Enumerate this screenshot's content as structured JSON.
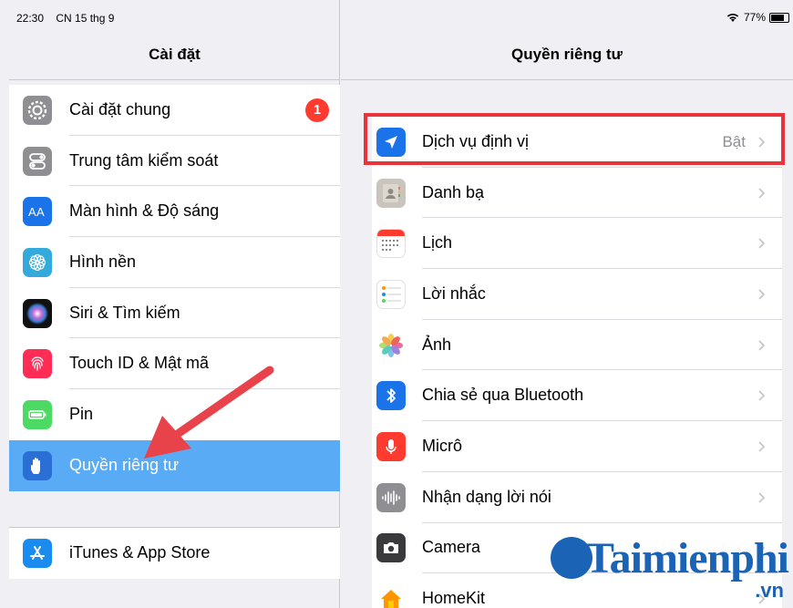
{
  "status": {
    "time": "22:30",
    "date": "CN 15 thg 9",
    "battery": "77%"
  },
  "left": {
    "title": "Cài đặt",
    "items": [
      {
        "label": "Cài đặt chung",
        "icon": "gear-icon",
        "badge": "1"
      },
      {
        "label": "Trung tâm kiểm soát",
        "icon": "control-center-icon"
      },
      {
        "label": "Màn hình & Độ sáng",
        "icon": "display-brightness-icon"
      },
      {
        "label": "Hình nền",
        "icon": "wallpaper-icon"
      },
      {
        "label": "Siri & Tìm kiếm",
        "icon": "siri-icon"
      },
      {
        "label": "Touch ID & Mật mã",
        "icon": "fingerprint-icon"
      },
      {
        "label": "Pin",
        "icon": "battery-icon"
      },
      {
        "label": "Quyền riêng tư",
        "icon": "privacy-hand-icon",
        "selected": true
      }
    ],
    "items2": [
      {
        "label": "iTunes & App Store",
        "icon": "app-store-icon"
      }
    ]
  },
  "right": {
    "title": "Quyền riêng tư",
    "items": [
      {
        "label": "Dịch vụ định vị",
        "icon": "location-arrow-icon",
        "value": "Bật"
      },
      {
        "label": "Danh bạ",
        "icon": "contacts-icon"
      },
      {
        "label": "Lịch",
        "icon": "calendar-icon"
      },
      {
        "label": "Lời nhắc",
        "icon": "reminders-icon"
      },
      {
        "label": "Ảnh",
        "icon": "photos-icon"
      },
      {
        "label": "Chia sẻ qua Bluetooth",
        "icon": "bluetooth-icon"
      },
      {
        "label": "Micrô",
        "icon": "microphone-icon"
      },
      {
        "label": "Nhận dạng lời nói",
        "icon": "speech-recognition-icon"
      },
      {
        "label": "Camera",
        "icon": "camera-icon"
      },
      {
        "label": "HomeKit",
        "icon": "homekit-icon"
      }
    ]
  },
  "colors": {
    "selected": "#5aabf5",
    "highlight": "#e8333a",
    "badge": "#ff3b30",
    "arrow": "#e8424a"
  },
  "watermark": {
    "text": "Taimienphi",
    "suffix": ".vn"
  }
}
